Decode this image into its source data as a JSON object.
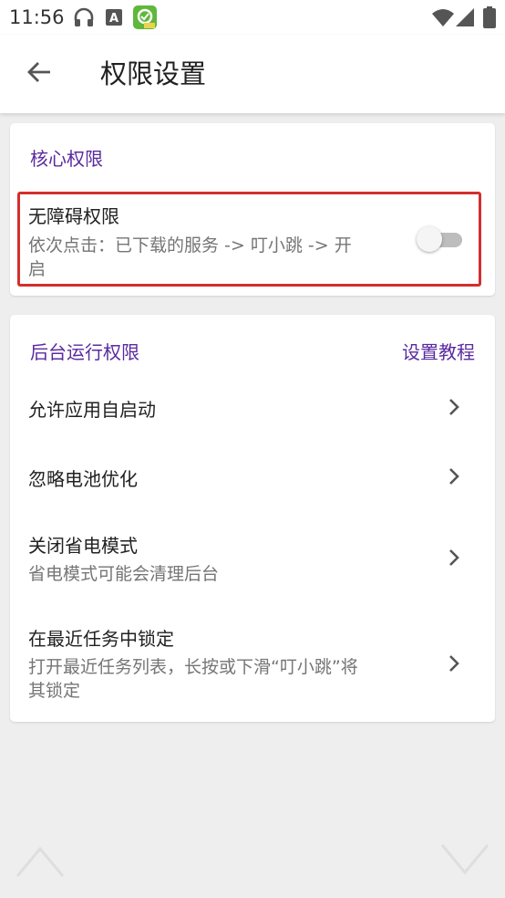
{
  "status_bar": {
    "time": "11:56",
    "icons": [
      "headphones-icon",
      "a-letter-icon",
      "app-badge-icon",
      "wifi-icon",
      "signal-icon",
      "battery-icon"
    ]
  },
  "app_bar": {
    "back_icon": "arrow-back-icon",
    "title": "权限设置"
  },
  "core_section": {
    "title": "核心权限",
    "accessibility": {
      "title": "无障碍权限",
      "subtitle_line1": "依次点击：已下载的服务 -> 叮小跳 -> 开",
      "subtitle_line2": "启",
      "toggle_on": false
    }
  },
  "background_section": {
    "title": "后台运行权限",
    "tutorial_link": "设置教程",
    "items": [
      {
        "title": "允许应用自启动",
        "subtitle": ""
      },
      {
        "title": "忽略电池优化",
        "subtitle": ""
      },
      {
        "title": "关闭省电模式",
        "subtitle": "省电模式可能会清理后台"
      },
      {
        "title": "在最近任务中锁定",
        "subtitle_line1": "打开最近任务列表，长按或下滑“叮小跳”将",
        "subtitle_line2": "其锁定"
      }
    ]
  },
  "colors": {
    "accent": "#5a2aa0",
    "highlight_border": "#d32f2f",
    "background": "#eeeeee"
  }
}
